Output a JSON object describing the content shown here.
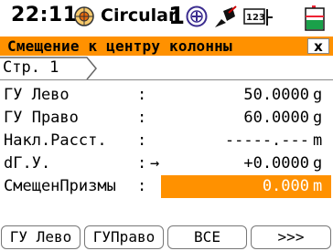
{
  "status": {
    "time": "22:11",
    "mode": "Circular",
    "face": "1",
    "icons": [
      "target-icon",
      "circle-target-icon",
      "laser-icon",
      "keypad-icon",
      "battery-icon"
    ]
  },
  "title": {
    "text": "Смещение к центру колонны",
    "close": "x"
  },
  "page": {
    "label": "Стр. 1"
  },
  "fields": [
    {
      "label": "ГУ Лево",
      "colon": ":",
      "value": "50.0000",
      "unit": "g"
    },
    {
      "label": "ГУ Право",
      "colon": ":",
      "value": "60.0000",
      "unit": "g"
    },
    {
      "label": "Накл.Расст.",
      "colon": ":",
      "value": "-----.---",
      "unit": "m"
    },
    {
      "label": "dГ.У.",
      "colon": ":",
      "arrow": "→",
      "value": "+0.0000",
      "unit": "g"
    },
    {
      "label": "СмещенПризмы",
      "colon": ":",
      "value": "0.000",
      "unit": "m"
    }
  ],
  "softkeys": [
    "ГУ Лево",
    "ГУПраво",
    "ВСЕ",
    ">>>"
  ],
  "colors": {
    "accent": "#ff9100",
    "background": "#ffffff"
  }
}
